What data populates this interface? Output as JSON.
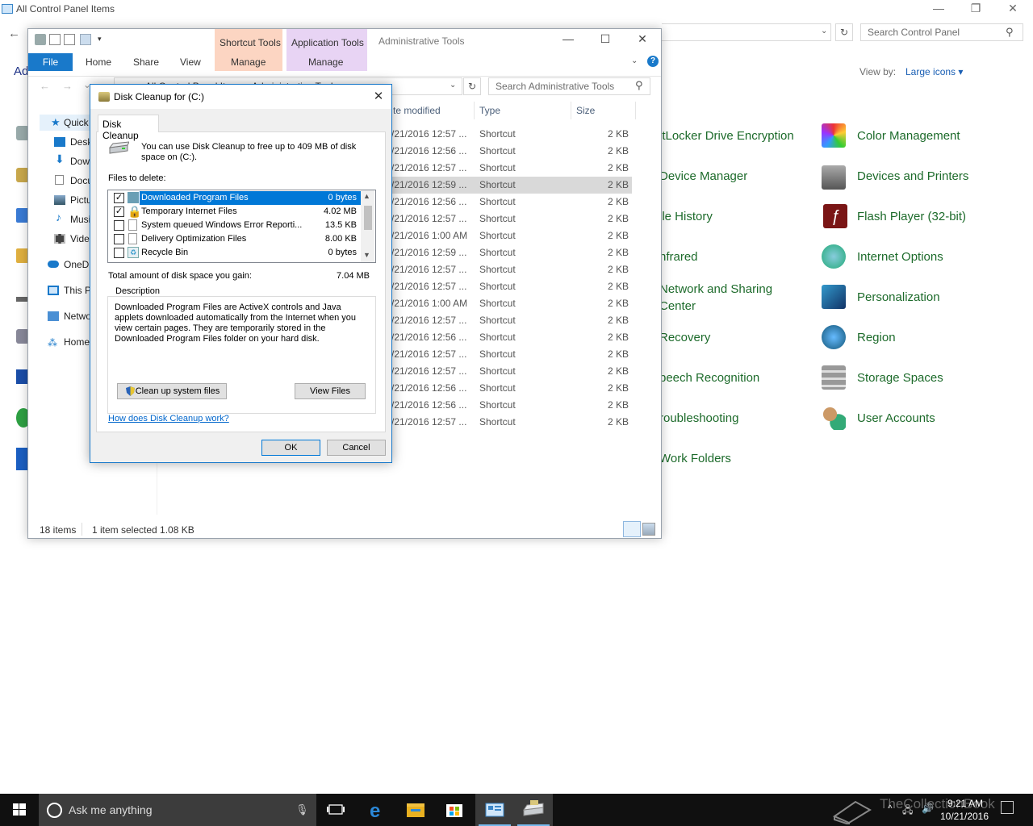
{
  "control_panel": {
    "title": "All Control Panel Items",
    "search_placeholder": "Search Control Panel",
    "heading_partial": "Ad",
    "view_by_label": "View by:",
    "view_by_value": "Large icons ▾",
    "items_col1": [
      {
        "label": "itLocker Drive Encryption"
      },
      {
        "label": "Device Manager"
      },
      {
        "label": "ile History"
      },
      {
        "label": "nfrared"
      },
      {
        "label": "Network and Sharing"
      },
      {
        "label": "Center"
      },
      {
        "label": "Recovery"
      },
      {
        "label": "peech Recognition"
      },
      {
        "label": "roubleshooting"
      },
      {
        "label": "Work Folders"
      }
    ],
    "items_col2": [
      {
        "label": "Color Management",
        "icon": "color-management-icon"
      },
      {
        "label": "Devices and Printers",
        "icon": "printer-icon"
      },
      {
        "label": "Flash Player (32-bit)",
        "icon": "flash-icon"
      },
      {
        "label": "Internet Options",
        "icon": "globe-icon"
      },
      {
        "label": "Personalization",
        "icon": "monitor-icon"
      },
      {
        "label": "Region",
        "icon": "region-globe-icon"
      },
      {
        "label": "Storage Spaces",
        "icon": "storage-icon"
      },
      {
        "label": "User Accounts",
        "icon": "users-icon"
      }
    ]
  },
  "explorer": {
    "title": "Administrative Tools",
    "context_tabs": {
      "shortcut": "Shortcut Tools",
      "application": "Application Tools"
    },
    "ribbon_tabs": {
      "file": "File",
      "home": "Home",
      "share": "Share",
      "view": "View",
      "manage1": "Manage",
      "manage2": "Manage"
    },
    "address": "All Control Panel Items  ›  Administrative Tools",
    "search_placeholder": "Search Administrative Tools",
    "nav": [
      {
        "label": "Quick"
      },
      {
        "label": "Desk"
      },
      {
        "label": "Dow"
      },
      {
        "label": "Docu"
      },
      {
        "label": "Pictu"
      },
      {
        "label": "Musi"
      },
      {
        "label": "Vide"
      },
      {
        "label": "OneD"
      },
      {
        "label": "This P"
      },
      {
        "label": "Netwo"
      },
      {
        "label": "Home"
      }
    ],
    "headers": {
      "date": "te modified",
      "type": "Type",
      "size": "Size"
    },
    "rows": [
      {
        "date": "/21/2016 12:57 ...",
        "type": "Shortcut",
        "size": "2 KB"
      },
      {
        "date": "/21/2016 12:56 ...",
        "type": "Shortcut",
        "size": "2 KB"
      },
      {
        "date": "/21/2016 12:57 ...",
        "type": "Shortcut",
        "size": "2 KB"
      },
      {
        "date": "/21/2016 12:59 ...",
        "type": "Shortcut",
        "size": "2 KB"
      },
      {
        "date": "/21/2016 12:56 ...",
        "type": "Shortcut",
        "size": "2 KB"
      },
      {
        "date": "/21/2016 12:57 ...",
        "type": "Shortcut",
        "size": "2 KB"
      },
      {
        "date": "/21/2016 1:00 AM",
        "type": "Shortcut",
        "size": "2 KB"
      },
      {
        "date": "/21/2016 12:59 ...",
        "type": "Shortcut",
        "size": "2 KB"
      },
      {
        "date": "/21/2016 12:57 ...",
        "type": "Shortcut",
        "size": "2 KB"
      },
      {
        "date": "/21/2016 12:57 ...",
        "type": "Shortcut",
        "size": "2 KB"
      },
      {
        "date": "/21/2016 1:00 AM",
        "type": "Shortcut",
        "size": "2 KB"
      },
      {
        "date": "/21/2016 12:57 ...",
        "type": "Shortcut",
        "size": "2 KB"
      },
      {
        "date": "/21/2016 12:56 ...",
        "type": "Shortcut",
        "size": "2 KB"
      },
      {
        "date": "/21/2016 12:57 ...",
        "type": "Shortcut",
        "size": "2 KB"
      },
      {
        "date": "/21/2016 12:57 ...",
        "type": "Shortcut",
        "size": "2 KB"
      },
      {
        "date": "/21/2016 12:56 ...",
        "type": "Shortcut",
        "size": "2 KB"
      },
      {
        "date": "/21/2016 12:56 ...",
        "type": "Shortcut",
        "size": "2 KB"
      },
      {
        "date": "/21/2016 12:57 ...",
        "type": "Shortcut",
        "size": "2 KB"
      }
    ],
    "selected_row_index": 3,
    "status": {
      "count": "18 items",
      "selection": "1 item selected  1.08 KB"
    }
  },
  "disk_cleanup": {
    "title": "Disk Cleanup for  (C:)",
    "tab": "Disk Cleanup",
    "intro": "You can use Disk Cleanup to free up to 409 MB of disk space on  (C:).",
    "files_label": "Files to delete:",
    "files": [
      {
        "name": "Downloaded Program Files",
        "size": "0 bytes",
        "checked": true,
        "selected": true
      },
      {
        "name": "Temporary Internet Files",
        "size": "4.02 MB",
        "checked": true,
        "selected": false
      },
      {
        "name": "System queued Windows Error Reporti...",
        "size": "13.5 KB",
        "checked": false,
        "selected": false
      },
      {
        "name": "Delivery Optimization Files",
        "size": "8.00 KB",
        "checked": false,
        "selected": false
      },
      {
        "name": "Recycle Bin",
        "size": "0 bytes",
        "checked": false,
        "selected": false
      }
    ],
    "total_label": "Total amount of disk space you gain:",
    "total_value": "7.04 MB",
    "description_legend": "Description",
    "description": "Downloaded Program Files are ActiveX controls and Java applets downloaded automatically from the Internet when you view certain pages. They are temporarily stored in the Downloaded Program Files folder on your hard disk.",
    "cleanup_button": "Clean up system files",
    "view_files_button": "View Files",
    "help_link": "How does Disk Cleanup work?",
    "ok_button": "OK",
    "cancel_button": "Cancel"
  },
  "taskbar": {
    "search_text": "Ask me anything",
    "time": "9:21 AM",
    "date": "10/21/2016",
    "watermark": "TheCollectionBook"
  },
  "colors": {
    "accent": "#0078d7",
    "cp_link_green": "#1d6b2b",
    "taskbar": "#101010"
  }
}
